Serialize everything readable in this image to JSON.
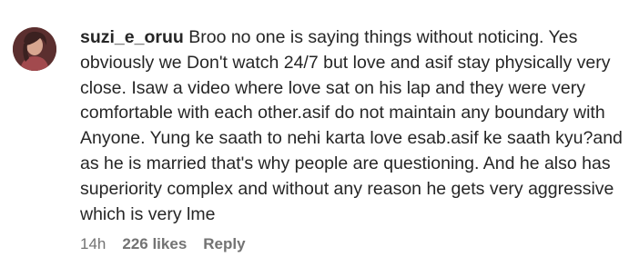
{
  "comment": {
    "username": "suzi_e_oruu",
    "text": "Broo no one is saying things without noticing. Yes obviously we Don't watch 24/7 but love and asif stay physically very close. Isaw a video where love sat on his lap and they were very comfortable with each other.asif do not maintain any boundary with Anyone. Yung ke saath to nehi karta love esab.asif ke saath kyu?and as he is married that's why people are questioning. And he also has superiority complex and without any reason he gets very aggressive which is very lme",
    "time": "14h",
    "likes": "226 likes",
    "reply_label": "Reply"
  },
  "avatar": {
    "icon": "user-avatar"
  }
}
